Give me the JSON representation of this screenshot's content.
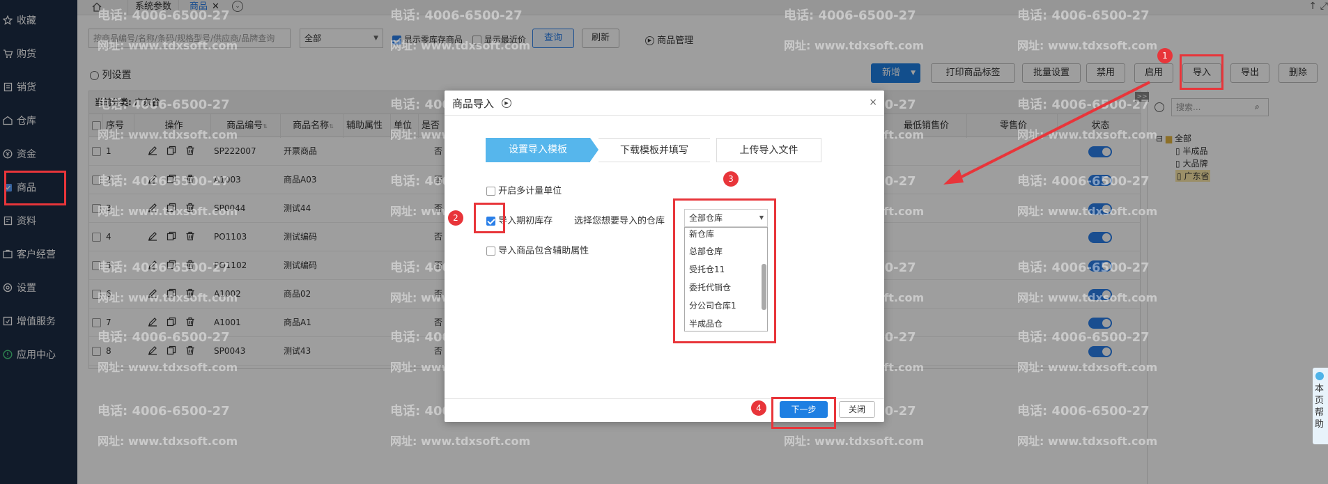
{
  "sidebar": {
    "items": [
      {
        "label": "收藏",
        "icon": "star-icon"
      },
      {
        "label": "购货",
        "icon": "cart-icon"
      },
      {
        "label": "销货",
        "icon": "sales-icon"
      },
      {
        "label": "仓库",
        "icon": "warehouse-icon"
      },
      {
        "label": "资金",
        "icon": "money-icon"
      },
      {
        "label": "商品",
        "icon": "product-icon"
      },
      {
        "label": "资料",
        "icon": "document-icon"
      },
      {
        "label": "客户经营",
        "icon": "customer-icon"
      },
      {
        "label": "设置",
        "icon": "gear-icon"
      },
      {
        "label": "增值服务",
        "icon": "service-icon"
      },
      {
        "label": "应用中心",
        "icon": "app-icon"
      }
    ]
  },
  "tabs": {
    "t1": "系统参数",
    "t2": "商品"
  },
  "toolbar": {
    "search_placeholder": "按商品编号/名称/条码/规格型号/供应商/品牌查询",
    "category_value": "全部",
    "zero_stock_label": "显示零库存商品",
    "recent_price_label": "显示最近价",
    "query_label": "查询",
    "refresh_label": "刷新",
    "manage_label": "商品管理"
  },
  "actionbar": {
    "column_settings": "列设置",
    "add": "新增",
    "print_labels": "打印商品标签",
    "batch_settings": "批量设置",
    "disable": "禁用",
    "enable": "启用",
    "import": "导入",
    "export": "导出",
    "delete": "删除"
  },
  "grid": {
    "current_category": "当前分类: 广东省",
    "headers": {
      "seq": "序号",
      "ops": "操作",
      "code": "商品编号",
      "name": "商品名称",
      "aux": "辅助属性",
      "unit": "单位",
      "flag": "是否",
      "min_price": "最低销售价",
      "retail": "零售价",
      "status": "状态"
    },
    "rows": [
      {
        "seq": "1",
        "code": "SP222007",
        "name": "开票商品",
        "flag": "否"
      },
      {
        "seq": "2",
        "code": "A1003",
        "name": "商品A03",
        "flag": "否"
      },
      {
        "seq": "3",
        "code": "SP0044",
        "name": "测试44",
        "flag": "否"
      },
      {
        "seq": "4",
        "code": "PO1103",
        "name": "测试编码",
        "flag": "否"
      },
      {
        "seq": "5",
        "code": "PO1102",
        "name": "测试编码",
        "flag": "否"
      },
      {
        "seq": "6",
        "code": "A1002",
        "name": "商品02",
        "flag": "否"
      },
      {
        "seq": "7",
        "code": "A1001",
        "name": "商品A1",
        "flag": "否"
      },
      {
        "seq": "8",
        "code": "SP0043",
        "name": "测试43",
        "flag": "否"
      }
    ]
  },
  "tree": {
    "search_placeholder": "搜索...",
    "root": "全部",
    "children": [
      "半成品",
      "大品牌",
      "广东省"
    ]
  },
  "watermark": {
    "phone": "电话: 4006-6500-27",
    "site": "网址: www.tdxsoft.com"
  },
  "modal": {
    "title": "商品导入",
    "steps": [
      "设置导入模板",
      "下载模板并填写",
      "上传导入文件"
    ],
    "multi_unit": "开启多计量单位",
    "initial_stock": "导入期初库存",
    "warehouse_prompt": "选择您想要导入的仓库",
    "warehouse_value": "全部仓库",
    "warehouse_options": [
      "新仓库",
      "总部仓库",
      "受托仓11",
      "委托代销仓",
      "分公司仓库1",
      "半成品仓"
    ],
    "aux_attr": "导入商品包含辅助属性",
    "next": "下一步",
    "close": "关闭"
  },
  "help": {
    "label": "本页帮助"
  },
  "annotations": [
    "1",
    "2",
    "3",
    "4"
  ]
}
